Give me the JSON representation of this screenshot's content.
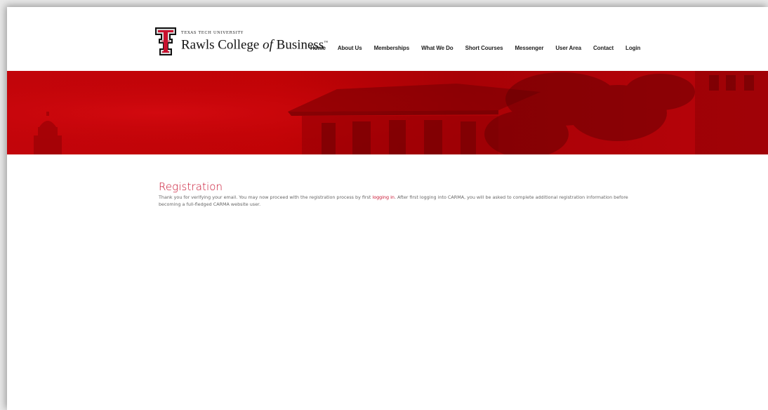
{
  "header": {
    "logo": {
      "university": "TEXAS TECH UNIVERSITY",
      "college_main": "Rawls College ",
      "college_of": "of",
      "college_end": " Business",
      "trademark": "™"
    },
    "nav": [
      "Home",
      "About Us",
      "Memberships",
      "What We Do",
      "Short Courses",
      "Messenger",
      "User Area",
      "Contact",
      "Login"
    ]
  },
  "colors": {
    "brand_red": "#c8102e",
    "banner_red": "#c10306"
  },
  "main": {
    "title": "Registration",
    "text_before_link": "Thank you for verifying your email. You may now proceed with the registration process by first ",
    "link_text": "logging in",
    "text_after_link": ". After first logging into CARMA, you will be asked to complete additional registration information before becoming a full-fledged CARMA website user."
  }
}
